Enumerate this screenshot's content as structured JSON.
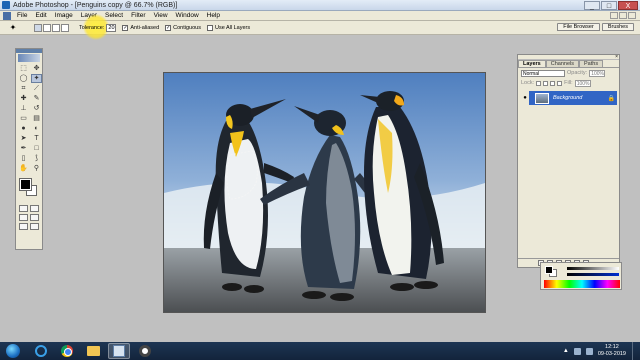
{
  "window": {
    "title": "Adobe Photoshop - [Penguins copy @ 66.7% (RGB)]",
    "buttons": [
      "_",
      "□",
      "X"
    ]
  },
  "menu": {
    "items": [
      "File",
      "Edit",
      "Image",
      "Layer",
      "Select",
      "Filter",
      "View",
      "Window",
      "Help"
    ]
  },
  "options": {
    "tolerance_label": "Tolerance:",
    "tolerance_value": "20",
    "anti_aliased_label": "Anti-aliased",
    "contiguous_label": "Contiguous",
    "use_all_layers_label": "Use All Layers",
    "palette_tabs": [
      "File Browser",
      "Brushes"
    ]
  },
  "layers_palette": {
    "tabs": [
      "Layers",
      "Channels",
      "Paths"
    ],
    "blend_mode": "Normal",
    "opacity_label": "Opacity:",
    "opacity_value": "100%",
    "lock_label": "Lock:",
    "fill_label": "Fill:",
    "fill_value": "100%",
    "layer_name": "Background"
  },
  "taskbar": {
    "time": "12:12",
    "date": "09-03-2019"
  },
  "colors": {
    "accent": "#3165c5",
    "highlight": "#ffe83a",
    "taskbar": "#1d3553"
  }
}
